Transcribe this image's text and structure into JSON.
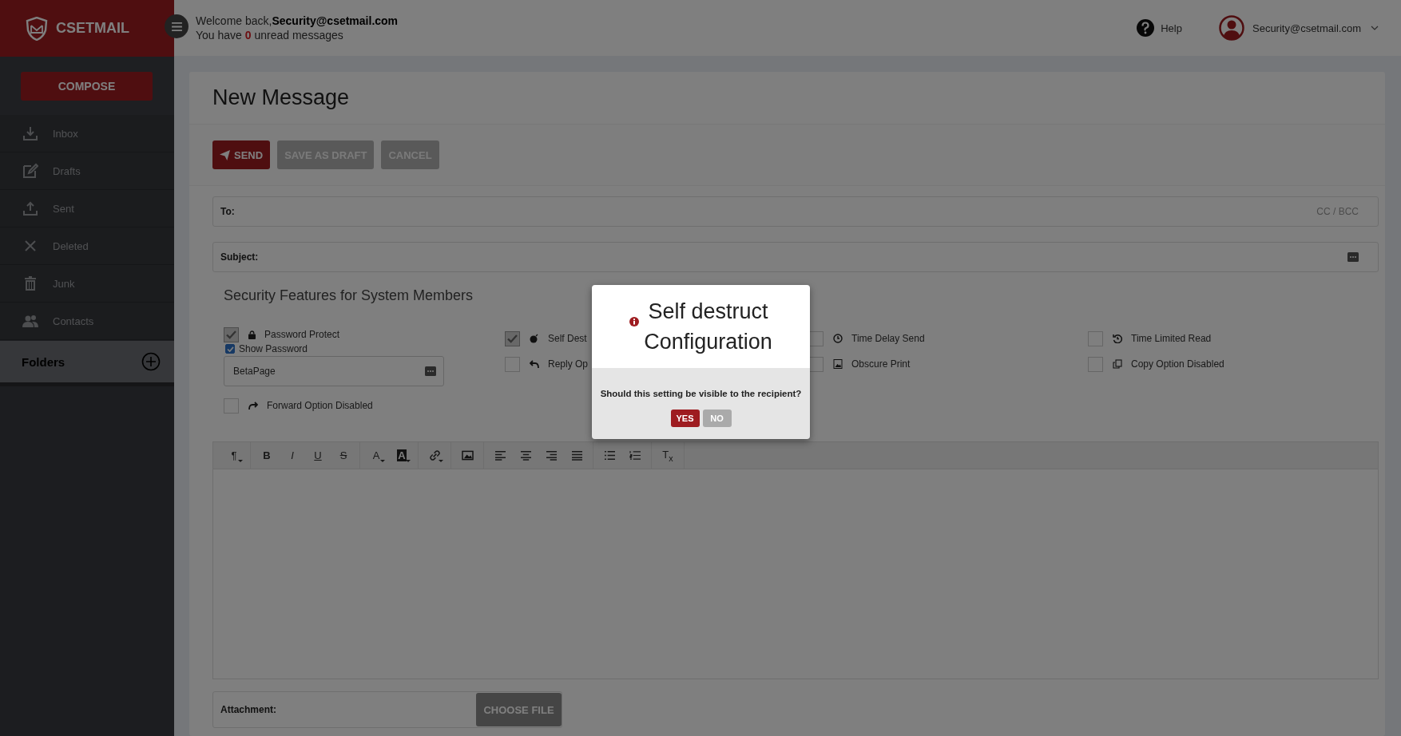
{
  "brand": {
    "name": "CSETMAIL"
  },
  "header": {
    "welcome": "Welcome back,",
    "user": "Security@csetmail.com",
    "unread_before": "You have ",
    "unread_count": "0",
    "unread_after": " unread messages",
    "help": "Help",
    "account": "Security@csetmail.com"
  },
  "sidebar": {
    "compose": "COMPOSE",
    "items": [
      {
        "label": "Inbox",
        "kind": "inbox"
      },
      {
        "label": "Drafts",
        "kind": "drafts"
      },
      {
        "label": "Sent",
        "kind": "sent"
      },
      {
        "label": "Deleted",
        "kind": "deleted"
      },
      {
        "label": "Junk",
        "kind": "junk"
      },
      {
        "label": "Contacts",
        "kind": "contacts"
      }
    ],
    "folders": "Folders"
  },
  "message": {
    "title": "New Message",
    "buttons": [
      {
        "label": "SEND",
        "kind": "primary"
      },
      {
        "label": "SAVE AS DRAFT",
        "kind": "secondary"
      },
      {
        "label": "CANCEL",
        "kind": "secondary"
      }
    ],
    "to_label": "To:",
    "cc_bcc": "CC / BCC",
    "subject_label": "Subject:"
  },
  "security": {
    "heading": "Security Features for System Members",
    "password": {
      "label": "Password Protect",
      "checked": true,
      "show_password": {
        "label": "Show Password",
        "checked": true
      },
      "value": "BetaPage"
    },
    "options": [
      {
        "label": "Self Dest",
        "checked": true,
        "kind": "bomb"
      },
      {
        "label": "Time Delay Send",
        "checked": false,
        "kind": "clock"
      },
      {
        "label": "Time Limited Read",
        "checked": false,
        "kind": "history"
      },
      {
        "label": "Reply Op",
        "checked": false,
        "kind": "reply"
      },
      {
        "label": "Obscure Print",
        "checked": false,
        "kind": "image"
      },
      {
        "label": "Copy Option Disabled",
        "checked": false,
        "kind": "copy"
      }
    ],
    "forward": {
      "label": "Forward Option Disabled",
      "checked": false
    }
  },
  "editor_toolbar": [
    [
      {
        "kind": "text",
        "label": "¶",
        "dropdown": true
      }
    ],
    [
      {
        "kind": "bold",
        "label": "B",
        "dropdown": false
      },
      {
        "kind": "italic",
        "label": "I",
        "dropdown": false
      },
      {
        "kind": "underline",
        "label": "U",
        "dropdown": false
      },
      {
        "kind": "strike",
        "label": "S",
        "dropdown": false
      }
    ],
    [
      {
        "kind": "text",
        "label": "A",
        "dropdown": true
      },
      {
        "kind": "highlight",
        "label": "A",
        "dropdown": true
      }
    ],
    [
      {
        "kind": "link",
        "dropdown": true
      }
    ],
    [
      {
        "kind": "image",
        "dropdown": false
      }
    ],
    [
      {
        "kind": "alignleft",
        "dropdown": false
      },
      {
        "kind": "aligncenter",
        "dropdown": false
      },
      {
        "kind": "alignright",
        "dropdown": false
      },
      {
        "kind": "justify",
        "dropdown": false
      }
    ],
    [
      {
        "kind": "bullets",
        "dropdown": false
      },
      {
        "kind": "numbers",
        "dropdown": false
      }
    ],
    [
      {
        "kind": "text",
        "label": "T$_{x}$",
        "dropdown": false
      }
    ]
  ],
  "attachment": {
    "label": "Attachment:",
    "button": "CHOOSE FILE"
  },
  "dialog": {
    "title_line1": "Self destruct",
    "title_line2": "Configuration",
    "question": "Should this setting be visible to the recipient?",
    "buttons": [
      {
        "label": "YES",
        "kind": "primary"
      },
      {
        "label": "NO",
        "kind": "secondary"
      }
    ]
  }
}
